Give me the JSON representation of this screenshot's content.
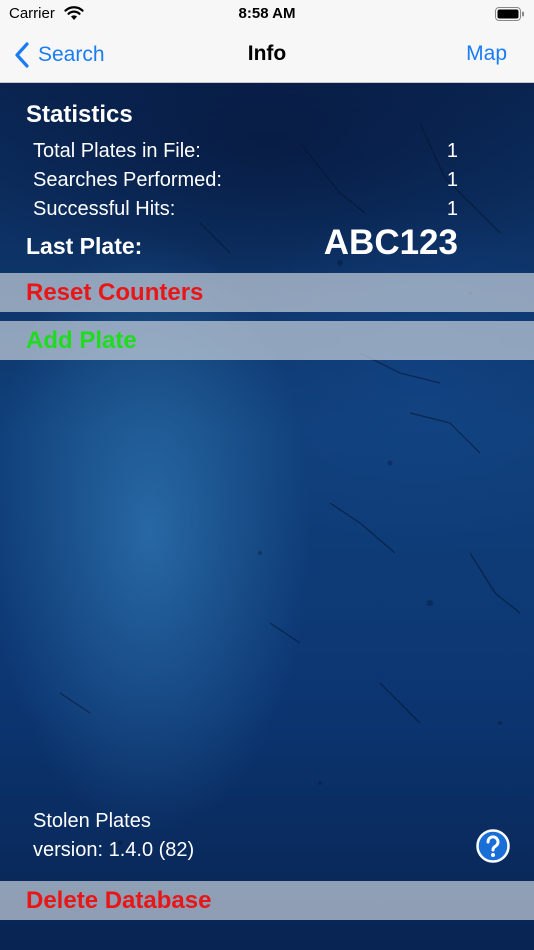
{
  "status_bar": {
    "carrier": "Carrier",
    "time": "8:58 AM"
  },
  "nav": {
    "back_label": "Search",
    "title": "Info",
    "right_label": "Map"
  },
  "statistics": {
    "title": "Statistics",
    "rows": [
      {
        "label": "Total Plates in File:",
        "value": "1"
      },
      {
        "label": "Searches Performed:",
        "value": "1"
      },
      {
        "label": "Successful Hits:",
        "value": "1"
      }
    ],
    "last_plate_label": "Last Plate:",
    "last_plate_value": "ABC123"
  },
  "actions": {
    "reset_label": "Reset Counters",
    "add_label": "Add Plate",
    "delete_label": "Delete Database"
  },
  "about": {
    "app_name": "Stolen Plates",
    "version": "version: 1.4.0 (82)"
  },
  "icons": {
    "back": "chevron-left-icon",
    "help": "question-circle-icon",
    "wifi": "wifi-icon",
    "battery": "battery-icon"
  },
  "colors": {
    "accent": "#1a7cf5",
    "danger": "#e81616",
    "success": "#1fdc1f",
    "help": "#1a6fd6"
  }
}
